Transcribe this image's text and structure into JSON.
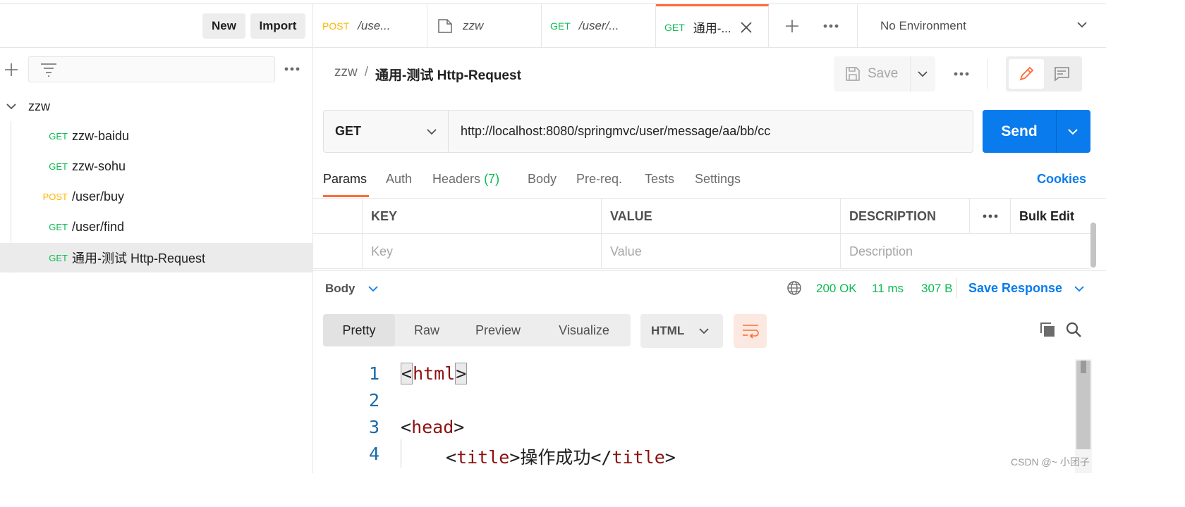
{
  "sidebar": {
    "new_label": "New",
    "import_label": "Import",
    "collection": {
      "name": "zzw",
      "requests": [
        {
          "method": "GET",
          "name": "zzw-baidu"
        },
        {
          "method": "GET",
          "name": "zzw-sohu"
        },
        {
          "method": "POST",
          "name": "/user/buy"
        },
        {
          "method": "GET",
          "name": "/user/find"
        },
        {
          "method": "GET",
          "name": "通用-测试 Http-Request",
          "selected": true
        }
      ]
    }
  },
  "tabs": [
    {
      "method": "POST",
      "title": "/use..."
    },
    {
      "method": "",
      "title": "zzw",
      "icon": "collection-icon"
    },
    {
      "method": "GET",
      "title": "/user/..."
    },
    {
      "method": "GET",
      "title": "通用-...",
      "active": true
    }
  ],
  "environment": "No Environment",
  "breadcrumb": {
    "collection": "zzw",
    "separator": "/",
    "request": "通用-测试 Http-Request"
  },
  "save_label": "Save",
  "request": {
    "method": "GET",
    "url": "http://localhost:8080/springmvc/user/message/aa/bb/cc",
    "send_label": "Send"
  },
  "request_tabs": {
    "params": "Params",
    "auth": "Auth",
    "headers": "Headers",
    "headers_count": "(7)",
    "body": "Body",
    "prereq": "Pre-req.",
    "tests": "Tests",
    "settings": "Settings",
    "cookies": "Cookies"
  },
  "params_table": {
    "headers": {
      "key": "KEY",
      "value": "VALUE",
      "description": "DESCRIPTION",
      "bulk_edit": "Bulk Edit"
    },
    "placeholders": {
      "key": "Key",
      "value": "Value",
      "description": "Description"
    }
  },
  "response": {
    "section_label": "Body",
    "status": "200 OK",
    "time": "11 ms",
    "size": "307 B",
    "save_response": "Save Response",
    "views": [
      "Pretty",
      "Raw",
      "Preview",
      "Visualize"
    ],
    "active_view": "Pretty",
    "language": "HTML",
    "code_lines": [
      {
        "num": "1",
        "text": "<html>"
      },
      {
        "num": "2",
        "text": ""
      },
      {
        "num": "3",
        "text": "<head>"
      },
      {
        "num": "4",
        "text": "<title>操作成功</title>"
      }
    ]
  },
  "colors": {
    "accent": "#ff6c37",
    "primary": "#097bed",
    "get": "#0cbb52",
    "post": "#ffb400"
  },
  "watermark": "CSDN @~ 小团子"
}
